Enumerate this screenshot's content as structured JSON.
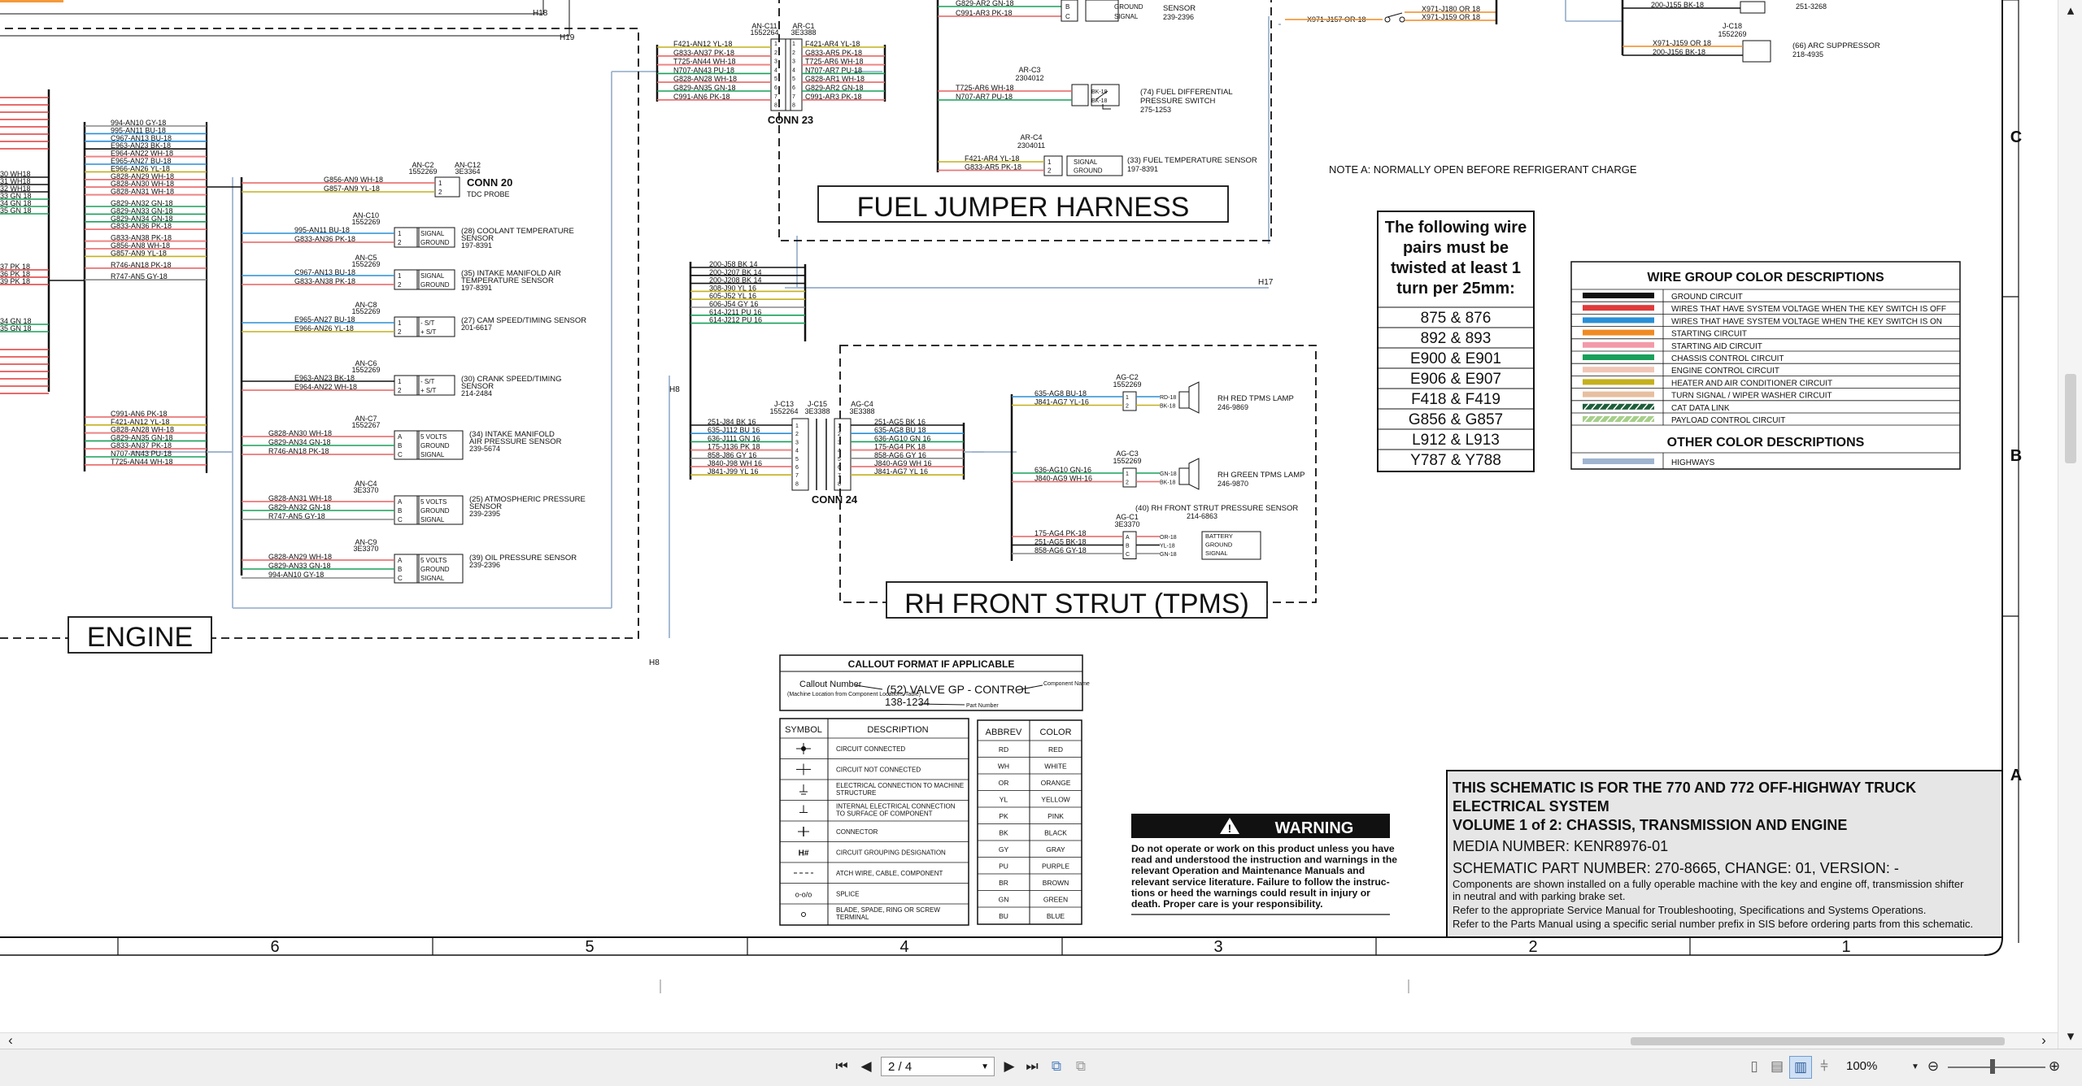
{
  "viewer": {
    "page_indicator": "2 / 4",
    "zoom": "100%",
    "icons": [
      "scroll-left-icon",
      "first-page-icon",
      "prev-page-icon",
      "next-page-icon",
      "last-page-icon",
      "page-dropdown-icon",
      "fit-icon",
      "single-page-icon",
      "two-page-icon",
      "continuous-icon",
      "zoom-dropdown-icon",
      "zoom-out-icon",
      "zoom-in-icon",
      "scroll-up-icon",
      "scroll-down-icon",
      "scroll-right-icon"
    ]
  },
  "harness_titles": {
    "engine": "ENGINE",
    "fuel": "FUEL JUMPER HARNESS",
    "tpms": "RH FRONT STRUT (TPMS)"
  },
  "connectors": {
    "conn20": "CONN 20",
    "conn20_desc": "TDC PROBE",
    "conn23": "CONN 23",
    "conn24": "CONN 24"
  },
  "note_a": "NOTE A: NORMALLY OPEN BEFORE REFRIGERANT CHARGE",
  "twisted": {
    "heading": [
      "The following wire",
      "pairs must be",
      "twisted at least 1",
      "turn per 25mm:"
    ],
    "pairs": [
      "875  &  876",
      "892  &  893",
      "E900  &  E901",
      "E906  &  E907",
      "F418  &  F419",
      "G856  &  G857",
      "L912  &  L913",
      "Y787  &  Y788"
    ]
  },
  "wire_groups": {
    "title": "WIRE GROUP COLOR DESCRIPTIONS",
    "items": [
      {
        "label": "GROUND CIRCUIT",
        "color": "#111111"
      },
      {
        "label": "WIRES THAT HAVE SYSTEM VOLTAGE WHEN THE KEY SWITCH IS OFF",
        "color": "#e03a3a"
      },
      {
        "label": "WIRES THAT HAVE SYSTEM VOLTAGE WHEN THE KEY SWITCH IS ON",
        "color": "#2a8fd6"
      },
      {
        "label": "STARTING CIRCUIT",
        "color": "#f08a22"
      },
      {
        "label": "STARTING AID CIRCUIT",
        "color": "#f39aa8"
      },
      {
        "label": "CHASSIS CONTROL CIRCUIT",
        "color": "#18a05a"
      },
      {
        "label": "ENGINE CONTROL CIRCUIT",
        "color": "#f2c6b6"
      },
      {
        "label": "HEATER AND AIR CONDITIONER CIRCUIT",
        "color": "#c4b01e"
      },
      {
        "label": "TURN SIGNAL / WIPER WASHER CIRCUIT",
        "color": "#e6bfa0"
      },
      {
        "label": "CAT DATA LINK",
        "color": "#1e5e3a",
        "striped": true
      },
      {
        "label": "PAYLOAD CONTROL CIRCUIT",
        "color": "#a6cf8a",
        "striped": true
      }
    ],
    "other_title": "OTHER COLOR DESCRIPTIONS",
    "other": [
      {
        "label": "HIGHWAYS",
        "color": "#9fb4cf"
      }
    ]
  },
  "callout": {
    "title": "CALLOUT FORMAT IF APPLICABLE",
    "callout_number": "Callout Number",
    "callout_sub": "(Machine Location from Component Locations Table)",
    "example": "(52) VALVE GP - CONTROL",
    "part": "138-1234",
    "component_name": "Component Name",
    "part_number": "Part Number"
  },
  "symbols": {
    "header_symbol": "SYMBOL",
    "header_desc": "DESCRIPTION",
    "rows": [
      "CIRCUIT CONNECTED",
      "CIRCUIT NOT CONNECTED",
      "ELECTRICAL CONNECTION TO MACHINE STRUCTURE",
      "INTERNAL ELECTRICAL CONNECTION TO SURFACE OF COMPONENT",
      "CONNECTOR",
      "CIRCUIT GROUPING DESIGNATION",
      "ATCH WIRE, CABLE, COMPONENT",
      "SPLICE",
      "BLADE, SPADE, RING OR SCREW TERMINAL"
    ]
  },
  "abbrev": {
    "header_abbrev": "ABBREV",
    "header_color": "COLOR",
    "rows": [
      [
        "RD",
        "RED"
      ],
      [
        "WH",
        "WHITE"
      ],
      [
        "OR",
        "ORANGE"
      ],
      [
        "YL",
        "YELLOW"
      ],
      [
        "PK",
        "PINK"
      ],
      [
        "BK",
        "BLACK"
      ],
      [
        "GY",
        "GRAY"
      ],
      [
        "PU",
        "PURPLE"
      ],
      [
        "BR",
        "BROWN"
      ],
      [
        "GN",
        "GREEN"
      ],
      [
        "BU",
        "BLUE"
      ]
    ]
  },
  "warning": {
    "title": "WARNING",
    "text": [
      "Do not operate or work on this product unless you have",
      "read and understood the instruction and warnings in the",
      "relevant Operation and Maintenance Manuals and",
      "relevant service literature. Failure to follow the instruc-",
      "tions or heed the warnings could result in injury or",
      "death. Proper care is your responsibility."
    ]
  },
  "title_block": {
    "line1": "THIS SCHEMATIC IS FOR THE 770 AND 772 OFF-HIGHWAY TRUCK",
    "line2": "ELECTRICAL SYSTEM",
    "line3": "VOLUME 1 of 2: CHASSIS, TRANSMISSION AND ENGINE",
    "media": "MEDIA NUMBER: KENR8976-01",
    "part": "SCHEMATIC PART NUMBER: 270-8665, CHANGE: 01, VERSION: -",
    "note1": "Components are shown installed on a fully operable machine with the key and engine off, transmission shifter",
    "note2": "in neutral and with parking brake set.",
    "note3": "Refer to the appropriate Service Manual for Troubleshooting, Specifications and Systems Operations.",
    "note4": "Refer to the Parts Manual using a specific serial number prefix in SIS before ordering parts from this schematic."
  },
  "grid": {
    "columns": [
      "6",
      "5",
      "4",
      "3",
      "2",
      "1"
    ],
    "rows": [
      "C",
      "B",
      "A"
    ]
  },
  "highway_labels": [
    "H18",
    "H19",
    "H17",
    "H8",
    "H8"
  ],
  "engine_sensors": [
    {
      "conn": "AN-C2",
      "part": "1552269",
      "conn2": "AN-C12",
      "part2": "3E3364",
      "wires": [
        "G856-AN9 WH-18",
        "G857-AN9 YL-18"
      ],
      "pins": [
        "1",
        "2"
      ],
      "name": "CONN 20"
    },
    {
      "conn": "AN-C10",
      "part": "1552269",
      "wires": [
        "995-AN11 BU-18",
        "G833-AN36 PK-18"
      ],
      "pins": [
        "1",
        "2"
      ],
      "funcs": [
        "SIGNAL",
        "GROUND"
      ],
      "name": "(28) COOLANT TEMPERATURE",
      "name2": "SENSOR",
      "pn": "197-8391"
    },
    {
      "conn": "AN-C5",
      "part": "1552269",
      "wires": [
        "C967-AN13 BU-18",
        "G833-AN38 PK-18"
      ],
      "pins": [
        "1",
        "2"
      ],
      "funcs": [
        "SIGNAL",
        "GROUND"
      ],
      "name": "(35) INTAKE MANIFOLD AIR",
      "name2": "TEMPERATURE SENSOR",
      "pn": "197-8391"
    },
    {
      "conn": "AN-C8",
      "part": "1552269",
      "wires": [
        "E965-AN27 BU-18",
        "E966-AN26 YL-18"
      ],
      "pins": [
        "1",
        "2"
      ],
      "funcs": [
        "- S/T",
        "+ S/T"
      ],
      "name": "(27) CAM SPEED/TIMING SENSOR",
      "pn": "201-6617"
    },
    {
      "conn": "AN-C6",
      "part": "1552269",
      "wires": [
        "E963-AN23 BK-18",
        "E964-AN22 WH-18"
      ],
      "pins": [
        "1",
        "2"
      ],
      "funcs": [
        "- S/T",
        "+ S/T"
      ],
      "name": "(30) CRANK SPEED/TIMING",
      "name2": "SENSOR",
      "pn": "214-2484"
    },
    {
      "conn": "AN-C7",
      "part": "1552267",
      "wires": [
        "G828-AN30 WH-18",
        "G829-AN34 GN-18",
        "R746-AN18 PK-18"
      ],
      "pins": [
        "A",
        "B",
        "C"
      ],
      "funcs": [
        "5 VOLTS",
        "GROUND",
        "SIGNAL"
      ],
      "name": "(34) INTAKE MANIFOLD",
      "name2": "AIR PRESSURE SENSOR",
      "pn": "239-5674"
    },
    {
      "conn": "AN-C4",
      "part": "3E3370",
      "wires": [
        "G828-AN31 WH-18",
        "G829-AN32 GN-18",
        "R747-AN5 GY-18"
      ],
      "pins": [
        "A",
        "B",
        "C"
      ],
      "funcs": [
        "5 VOLTS",
        "GROUND",
        "SIGNAL"
      ],
      "name": "(25) ATMOSPHERIC PRESSURE",
      "name2": "SENSOR",
      "pn": "239-2395"
    },
    {
      "conn": "AN-C9",
      "part": "3E3370",
      "wires": [
        "G828-AN29 WH-18",
        "G829-AN33 GN-18",
        "994-AN10 GY-18"
      ],
      "pins": [
        "A",
        "B",
        "C"
      ],
      "funcs": [
        "5 VOLTS",
        "GROUND",
        "SIGNAL"
      ],
      "name": "(39) OIL PRESSURE SENSOR",
      "pn": "239-2396"
    }
  ],
  "engine_bus_labels": [
    "994-AN10 GY-18",
    "995-AN11 BU-18",
    "C967-AN13 BU-18",
    "E963-AN23 BK-18",
    "E964-AN22 WH-18",
    "E965-AN27 BU-18",
    "E966-AN26 YL-18",
    "G828-AN29 WH-18",
    "G828-AN30 WH-18",
    "G828-AN31 WH-18",
    "",
    "G829-AN32 GN-18",
    "G829-AN33 GN-18",
    "G829-AN34 GN-18",
    "G833-AN36 PK-18",
    "",
    "G833-AN38 PK-18",
    "G856-AN8 WH-18",
    "G857-AN9 YL-18",
    "",
    "R746-AN18 PK-18",
    "",
    "R747-AN5 GY-18"
  ],
  "engine_bus2_labels": [
    "C991-AN6 PK-18",
    "F421-AN12 YL-18",
    "G828-AN28 WH-18",
    "G829-AN35 GN-18",
    "G833-AN37 PK-18",
    "N707-AN43 PU-18",
    "T725-AN44 WH-18"
  ],
  "left_cut_labels": [
    "30 WH18",
    "31 WH18",
    "32 WH18",
    "33 GN 18",
    "34 GN 18",
    "35 GN 18",
    "37 PK 18",
    "36 PK 18",
    "39 PK 18",
    "34 GN 18",
    "35 GN 18"
  ],
  "fuel_conn23": {
    "conn_a": "AN-C11",
    "part_a": "1552264",
    "conn_b": "AR-C1",
    "part_b": "3E3388",
    "left": [
      "F421-AN12 YL-18",
      "G833-AN37 PK-18",
      "T725-AN44 WH-18",
      "N707-AN43 PU-18",
      "G828-AN28 WH-18",
      "G829-AN35 GN-18",
      "C991-AN6 PK-18"
    ],
    "right": [
      "F421-AR4 YL-18",
      "G833-AR5 PK-18",
      "T725-AR6 WH-18",
      "N707-AR7 PU-18",
      "G828-AR1 WH-18",
      "G829-AR2 GN-18",
      "C991-AR3 PK-18"
    ],
    "pins": [
      "1",
      "2",
      "3",
      "4",
      "5",
      "6",
      "7",
      "8"
    ]
  },
  "fuel_top": {
    "wires": [
      "G829-AR2 GN-18",
      "C991-AR3 PK-18"
    ],
    "pins": [
      "B",
      "C"
    ],
    "funcs": [
      "GROUND",
      "SIGNAL"
    ],
    "name": "SENSOR",
    "pn": "239-2396"
  },
  "fuel_c3": {
    "conn": "AR-C3",
    "part": "2304012",
    "wires": [
      "T725-AR6 WH-18",
      "N707-AR7 PU-18"
    ],
    "name": "(74) FUEL DIFFERENTIAL",
    "name2": "PRESSURE SWITCH",
    "pn": "275-1253"
  },
  "fuel_c4": {
    "conn": "AR-C4",
    "part": "2304011",
    "wires": [
      "F421-AR4 YL-18",
      "G833-AR5 PK-18"
    ],
    "funcs": [
      "SIGNAL",
      "GROUND"
    ],
    "name": "(33) FUEL TEMPERATURE SENSOR",
    "pn": "197-8391"
  },
  "top_right": {
    "switch_left": "X971-J157 OR-18",
    "switch_right": [
      "X971-J180 OR 18",
      "X971-J159 OR 18"
    ],
    "wire_top": "200-J155 BK-18",
    "pn_top": "251-3268",
    "conn": "J-C18",
    "part": "1552269",
    "wires": [
      "X971-J159 OR 18",
      "200-J156 BK-18"
    ],
    "name": "(66) ARC SUPPRESSOR",
    "pn": "218-4935"
  },
  "mid_bus_labels": [
    "200-J58 BK 14",
    "200-J207 BK 14",
    "200-J208 BK 14",
    "308-J90 YL 16",
    "605-J52 YL 16",
    "606-J54 GY 16",
    "614-J211 PU 16",
    "614-J212 PU 16"
  ],
  "conn24": {
    "conn_a": "J-C13",
    "part_a": "1552264",
    "conn_b": "J-C15",
    "part_b": "3E3388",
    "conn_c": "AG-C4",
    "part_c": "3E3388",
    "left": [
      "251-J84 BK 16",
      "635-J112 BU 16",
      "636-J111 GN 16",
      "175-J136 PK 18",
      "858-J86 GY 16",
      "J840-J98 WH 16",
      "J841-J99 YL 16"
    ],
    "right": [
      "251-AG5 BK 16",
      "635-AG8 BU 18",
      "636-AG10 GN 16",
      "175-AG4 PK 18",
      "858-AG6 GY 16",
      "J840-AG9 WH 16",
      "J841-AG7 YL 16"
    ],
    "pins": [
      "1",
      "2",
      "3",
      "4",
      "5",
      "6",
      "7",
      "8"
    ]
  },
  "tpms": [
    {
      "conn": "AG-C2",
      "part": "1552269",
      "wires": [
        "635-AG8 BU-18",
        "J841-AG7 YL-16"
      ],
      "pins": [
        "1",
        "2"
      ],
      "lamp_wires": [
        "RD-18",
        "BK-18"
      ],
      "name": "RH RED TPMS LAMP",
      "pn": "246-9869"
    },
    {
      "conn": "AG-C3",
      "part": "1552269",
      "wires": [
        "636-AG10 GN-16",
        "J840-AG9 WH-16"
      ],
      "pins": [
        "1",
        "2"
      ],
      "lamp_wires": [
        "GN-18",
        "BK-18"
      ],
      "name": "RH GREEN TPMS LAMP",
      "pn": "246-9870"
    },
    {
      "conn": "AG-C1",
      "part": "3E3370",
      "wires": [
        "175-AG4 PK-18",
        "251-AG5 BK-18",
        "858-AG6 GY-18"
      ],
      "pins": [
        "A",
        "B",
        "C"
      ],
      "lamp_wires": [
        "OR-18",
        "YL-18",
        "GN-18"
      ],
      "funcs": [
        "BATTERY",
        "GROUND",
        "SIGNAL"
      ],
      "name": "(40) RH FRONT STRUT PRESSURE SENSOR",
      "pn": "214-6863"
    }
  ]
}
